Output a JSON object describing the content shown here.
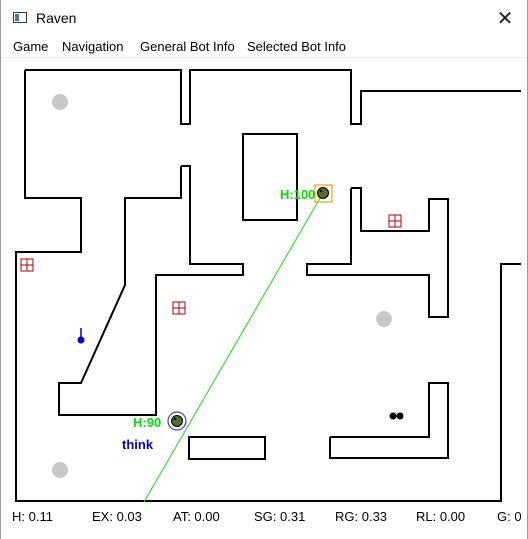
{
  "window": {
    "title": "Raven",
    "close_glyph": "✕"
  },
  "menu": {
    "game": "Game",
    "navigation": "Navigation",
    "general_bot_info": "General Bot Info",
    "selected_bot_info": "Selected Bot Info"
  },
  "bots": {
    "selected": {
      "health": "H:100"
    },
    "other": {
      "health": "H:90",
      "status": "think"
    }
  },
  "colors": {
    "wall": "#000000",
    "health_text": "#00dd00",
    "status_text": "#0000cc",
    "line_of_fire": "#33dd33",
    "spawn_point": "#c8c8c8",
    "item_box": "#cc0000",
    "selection_box": "#ff9900"
  },
  "status": {
    "h": "H: 0.11",
    "ex": "EX: 0.03",
    "at": "AT: 0.00",
    "sg": "SG: 0.31",
    "rg": "RG: 0.33",
    "rl": "RL: 0.00",
    "g": "G: 0"
  }
}
